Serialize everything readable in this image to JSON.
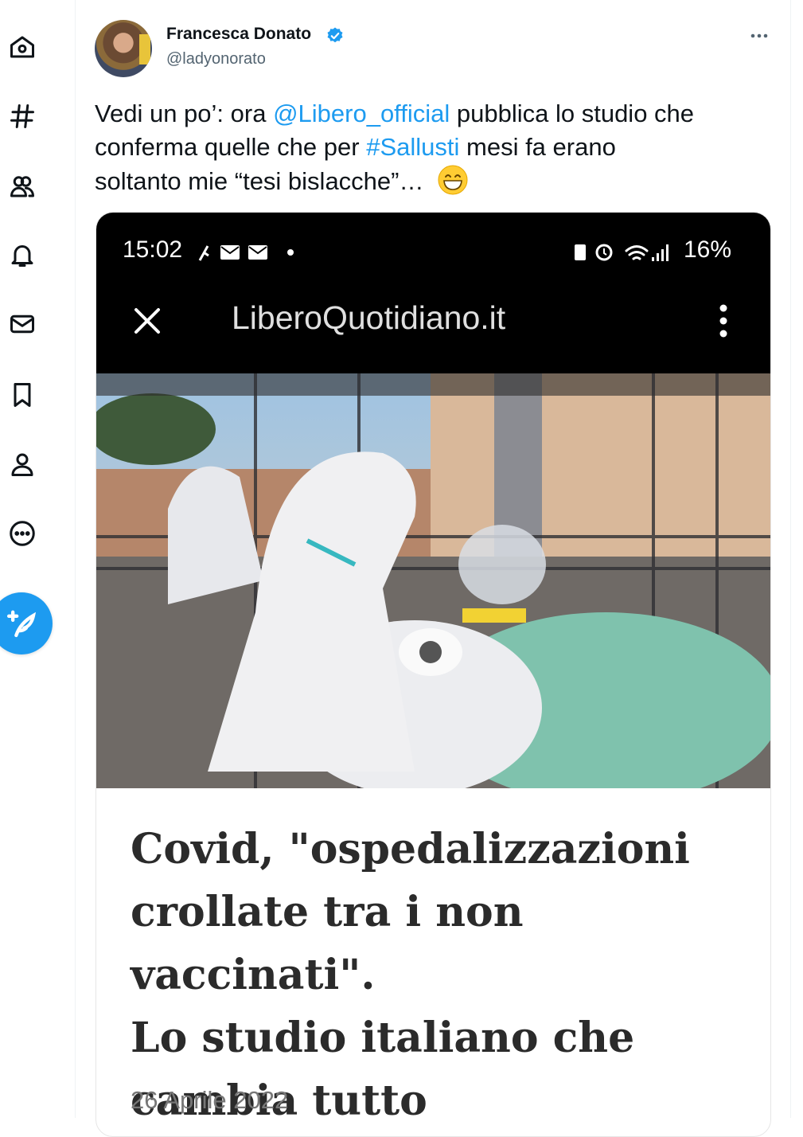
{
  "sidebar": {
    "items": [
      {
        "name": "home-icon",
        "label": "Home"
      },
      {
        "name": "explore-icon",
        "label": "Explore"
      },
      {
        "name": "communities-icon",
        "label": "Communities"
      },
      {
        "name": "notifications-icon",
        "label": "Notifications"
      },
      {
        "name": "messages-icon",
        "label": "Messages"
      },
      {
        "name": "bookmarks-icon",
        "label": "Bookmarks"
      },
      {
        "name": "profile-icon",
        "label": "Profile"
      },
      {
        "name": "more-icon",
        "label": "More"
      }
    ],
    "compose_icon": "compose-feather-icon"
  },
  "tweet": {
    "display_name": "Francesca Donato",
    "handle": "@ladyonorato",
    "verified": true,
    "text": {
      "p1": "Vedi un po’: ora ",
      "mention": "@Libero_official",
      "p2": " pubblica lo studio che",
      "p3": "conferma quelle che per ",
      "hashtag": "#Sallusti",
      "p4": " mesi fa erano",
      "p5": "soltanto mie “tesi bislacche”… ",
      "emoji": "grinning-face-emoji"
    }
  },
  "screenshot": {
    "status_time": "15:02",
    "battery": "16%",
    "site_title": "LiberoQuotidiano.it",
    "article_title_lines": [
      "Covid, \"ospedalizzazioni",
      "crollate tra i non vaccinati\".",
      "Lo studio italiano che",
      "cambia tutto"
    ],
    "article_date": "26 Aprile 2022"
  },
  "colors": {
    "accent": "#1d9bf0",
    "text": "#0f1419",
    "secondary": "#536471"
  }
}
